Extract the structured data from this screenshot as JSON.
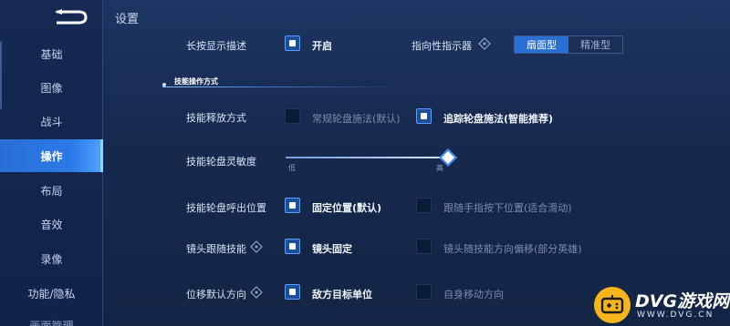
{
  "page_title": "设置",
  "sidebar": {
    "items": [
      {
        "label": "基础",
        "active": false
      },
      {
        "label": "图像",
        "active": false
      },
      {
        "label": "战斗",
        "active": false
      },
      {
        "label": "操作",
        "active": true
      },
      {
        "label": "布局",
        "active": false
      },
      {
        "label": "音效",
        "active": false
      },
      {
        "label": "录像",
        "active": false
      },
      {
        "label": "功能/隐私",
        "active": false
      },
      {
        "label": "画面管理",
        "active": false
      }
    ]
  },
  "settings": {
    "long_press": {
      "label": "长按显示描述",
      "option": "开启",
      "checked": true
    },
    "indicator": {
      "label": "指向性指示器",
      "options": [
        "扇面型",
        "精准型"
      ],
      "selected": "扇面型"
    },
    "section_title": "技能操作方式",
    "release_mode": {
      "label": "技能释放方式",
      "options": [
        {
          "label": "常规轮盘施法(默认)",
          "checked": false
        },
        {
          "label": "追踪轮盘施法(智能推荐)",
          "checked": true
        }
      ]
    },
    "sensitivity": {
      "label": "技能轮盘灵敏度",
      "min_label": "低",
      "max_label": "高",
      "value": 1.0
    },
    "wheel_position": {
      "label": "技能轮盘呼出位置",
      "options": [
        {
          "label": "固定位置(默认)",
          "checked": true
        },
        {
          "label": "跟随手指按下位置(适合滑动)",
          "checked": false
        }
      ]
    },
    "camera_follow": {
      "label": "镜头跟随技能",
      "options": [
        {
          "label": "镜头固定",
          "checked": true
        },
        {
          "label": "镜头随技能方向偏移(部分英雄)",
          "checked": false
        }
      ]
    },
    "move_direction": {
      "label": "位移默认方向",
      "options": [
        {
          "label": "敌方目标单位",
          "checked": true
        },
        {
          "label": "自身移动方向",
          "checked": false
        }
      ]
    }
  },
  "watermark": {
    "name": "DVG游戏网",
    "url": "WWW.DVG.CN"
  },
  "colors": {
    "accent": "#2a6fd6",
    "background": "#16294d"
  }
}
